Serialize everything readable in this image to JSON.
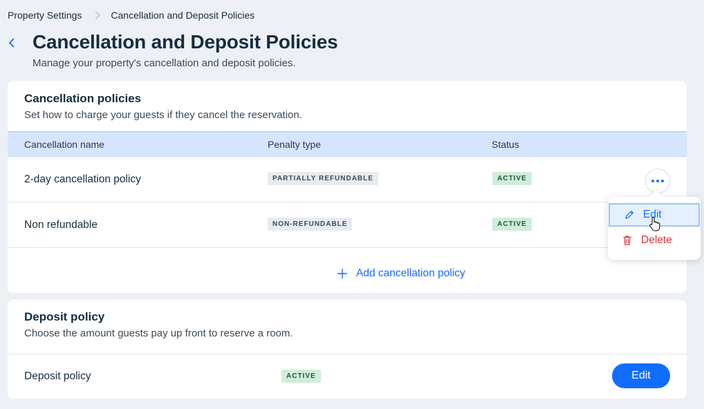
{
  "breadcrumb": {
    "parent": "Property Settings",
    "current": "Cancellation and Deposit Policies"
  },
  "page": {
    "title": "Cancellation and Deposit Policies",
    "subtitle": "Manage your property's cancellation and deposit policies."
  },
  "cancellation": {
    "title": "Cancellation policies",
    "description": "Set how to charge your guests if they cancel the reservation.",
    "columns": {
      "name": "Cancellation name",
      "penalty": "Penalty type",
      "status": "Status"
    },
    "rows": [
      {
        "name": "2-day cancellation policy",
        "penalty": "PARTIALLY REFUNDABLE",
        "status": "ACTIVE"
      },
      {
        "name": "Non refundable",
        "penalty": "NON-REFUNDABLE",
        "status": "ACTIVE"
      }
    ],
    "add_label": "Add cancellation policy"
  },
  "menu": {
    "edit": "Edit",
    "delete": "Delete"
  },
  "deposit": {
    "title": "Deposit policy",
    "description": "Choose the amount guests pay up front to reserve a room.",
    "row_name": "Deposit policy",
    "status": "ACTIVE",
    "edit_label": "Edit"
  },
  "icons": {
    "breadcrumb_separator": "chevron-right-icon",
    "back": "chevron-left-icon",
    "more": "more-horizontal-icon",
    "add": "plus-icon",
    "edit": "pencil-icon",
    "delete": "trash-icon",
    "cursor": "hand-pointer-icon"
  },
  "colors": {
    "accent": "#116dff",
    "danger": "#df3131",
    "active_bg": "#d2ecdb",
    "table_header": "#d6e6fe"
  }
}
